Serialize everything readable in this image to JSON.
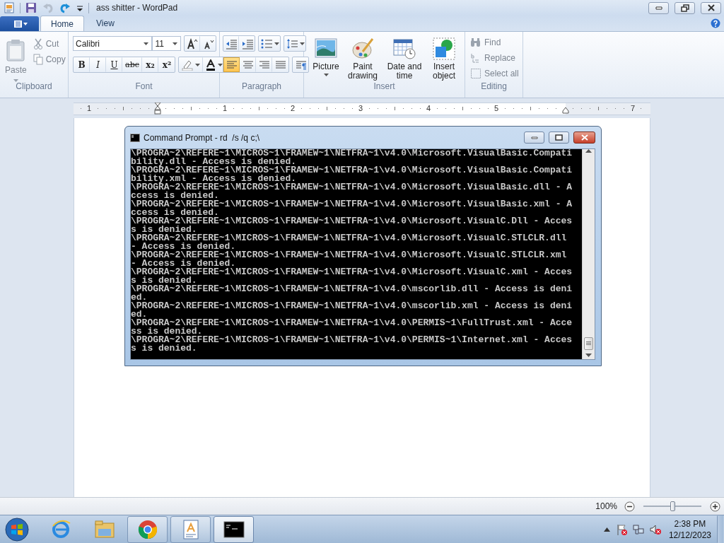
{
  "window": {
    "title": "ass shitter - WordPad"
  },
  "tabs": [
    {
      "label": "Home",
      "selected": true
    },
    {
      "label": "View",
      "selected": false
    }
  ],
  "ribbon": {
    "clipboard": {
      "label": "Clipboard",
      "paste": {
        "label": "Paste",
        "disabled": true
      },
      "items": [
        {
          "label": "Cut",
          "disabled": true
        },
        {
          "label": "Copy",
          "disabled": true
        }
      ]
    },
    "font": {
      "label": "Font",
      "family": "Calibri",
      "size": "11",
      "formats": [
        {
          "kind": "bold",
          "label": "B"
        },
        {
          "kind": "italic",
          "label": "I"
        },
        {
          "kind": "underline",
          "label": "U"
        },
        {
          "kind": "strike",
          "label": "abc"
        },
        {
          "kind": "sub",
          "label": "x₂"
        },
        {
          "kind": "super",
          "label": "x²"
        }
      ]
    },
    "paragraph": {
      "label": "Paragraph",
      "alignments": [
        {
          "selected": true
        },
        {
          "selected": false
        },
        {
          "selected": false
        },
        {
          "selected": false
        }
      ]
    },
    "insert": {
      "label": "Insert",
      "items": [
        {
          "label": "Picture"
        },
        {
          "label": "Paint drawing"
        },
        {
          "label": "Date and time"
        },
        {
          "label": "Insert object"
        }
      ]
    },
    "editing": {
      "label": "Editing",
      "items": [
        {
          "label": "Find",
          "disabled": true
        },
        {
          "label": "Replace",
          "disabled": true
        },
        {
          "label": "Select all",
          "disabled": true
        }
      ]
    }
  },
  "ruler": {
    "labels": [
      "1",
      "1",
      "2",
      "3",
      "4",
      "5",
      "7"
    ]
  },
  "console": {
    "title": "Command Prompt - rd  /s /q c;\\",
    "lines": [
      "\\PROGRA~2\\REFERE~1\\MICROS~1\\FRAMEW~1\\NETFRA~1\\v4.0\\Microsoft.VisualBasic.Compati",
      "bility.dll - Access is denied.",
      "\\PROGRA~2\\REFERE~1\\MICROS~1\\FRAMEW~1\\NETFRA~1\\v4.0\\Microsoft.VisualBasic.Compati",
      "bility.xml - Access is denied.",
      "\\PROGRA~2\\REFERE~1\\MICROS~1\\FRAMEW~1\\NETFRA~1\\v4.0\\Microsoft.VisualBasic.dll - A",
      "ccess is denied.",
      "\\PROGRA~2\\REFERE~1\\MICROS~1\\FRAMEW~1\\NETFRA~1\\v4.0\\Microsoft.VisualBasic.xml - A",
      "ccess is denied.",
      "\\PROGRA~2\\REFERE~1\\MICROS~1\\FRAMEW~1\\NETFRA~1\\v4.0\\Microsoft.VisualC.Dll - Acces",
      "s is denied.",
      "\\PROGRA~2\\REFERE~1\\MICROS~1\\FRAMEW~1\\NETFRA~1\\v4.0\\Microsoft.VisualC.STLCLR.dll",
      "- Access is denied.",
      "\\PROGRA~2\\REFERE~1\\MICROS~1\\FRAMEW~1\\NETFRA~1\\v4.0\\Microsoft.VisualC.STLCLR.xml",
      "- Access is denied.",
      "\\PROGRA~2\\REFERE~1\\MICROS~1\\FRAMEW~1\\NETFRA~1\\v4.0\\Microsoft.VisualC.xml - Acces",
      "s is denied.",
      "\\PROGRA~2\\REFERE~1\\MICROS~1\\FRAMEW~1\\NETFRA~1\\v4.0\\mscorlib.dll - Access is deni",
      "ed.",
      "\\PROGRA~2\\REFERE~1\\MICROS~1\\FRAMEW~1\\NETFRA~1\\v4.0\\mscorlib.xml - Access is deni",
      "ed.",
      "\\PROGRA~2\\REFERE~1\\MICROS~1\\FRAMEW~1\\NETFRA~1\\v4.0\\PERMIS~1\\FullTrust.xml - Acce",
      "ss is denied.",
      "\\PROGRA~2\\REFERE~1\\MICROS~1\\FRAMEW~1\\NETFRA~1\\v4.0\\PERMIS~1\\Internet.xml - Acces",
      "s is denied."
    ]
  },
  "status_bar": {
    "zoom": "100%",
    "level": 0.5
  },
  "taskbar": {
    "items": [
      {
        "kind": "pinned",
        "selected": false
      },
      {
        "kind": "pinned",
        "selected": false
      },
      {
        "kind": "running",
        "selected": false
      },
      {
        "kind": "running",
        "selected": false
      },
      {
        "kind": "running",
        "selected": true
      }
    ],
    "clock": {
      "time": "2:38 PM",
      "date": "12/12/2023"
    }
  }
}
